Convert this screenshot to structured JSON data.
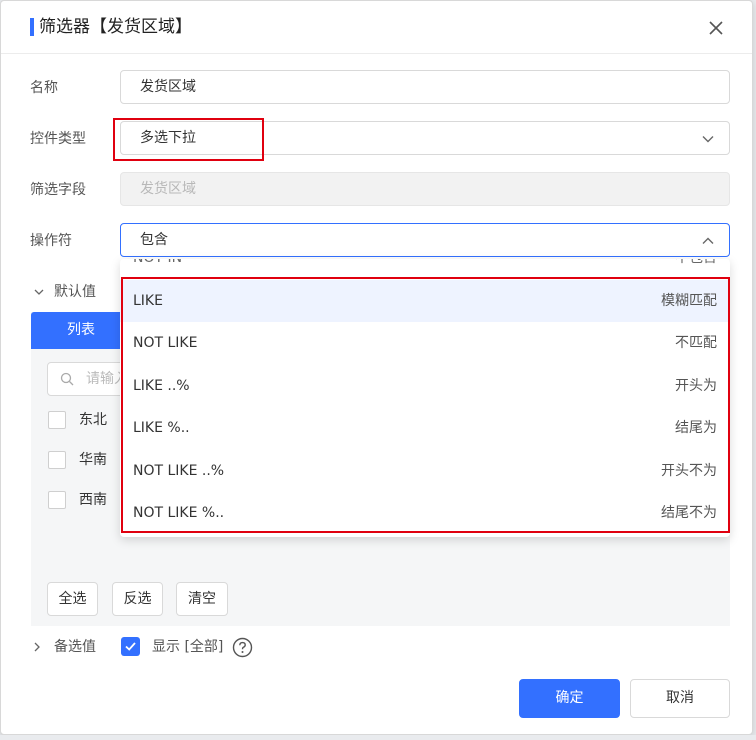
{
  "dialog": {
    "title": "筛选器【发货区域】"
  },
  "form": {
    "name_label": "名称",
    "name_value": "发货区域",
    "control_type_label": "控件类型",
    "control_type_value": "多选下拉",
    "filter_field_label": "筛选字段",
    "filter_field_value": "发货区域",
    "operator_label": "操作符",
    "operator_value": "包含"
  },
  "operator_dropdown": {
    "partial_option": {
      "label": "NOT IN",
      "desc": "不包含"
    },
    "options": [
      {
        "label": "LIKE",
        "desc": "模糊匹配",
        "highlighted": true
      },
      {
        "label": "NOT LIKE",
        "desc": "不匹配",
        "highlighted": false
      },
      {
        "label": "LIKE ..%",
        "desc": "开头为",
        "highlighted": false
      },
      {
        "label": "LIKE %..",
        "desc": "结尾为",
        "highlighted": false
      },
      {
        "label": "NOT LIKE ..%",
        "desc": "开头不为",
        "highlighted": false
      },
      {
        "label": "NOT LIKE %..",
        "desc": "结尾不为",
        "highlighted": false
      }
    ]
  },
  "default_value": {
    "section_label": "默认值",
    "tab_label": "列表",
    "search_placeholder": "请输入",
    "items": [
      "东北",
      "华南",
      "西南"
    ],
    "select_all": "全选",
    "invert": "反选",
    "clear": "清空"
  },
  "candidate": {
    "section_label": "备选值",
    "show_all_label": "显示 [全部]",
    "show_all_checked": true
  },
  "footer": {
    "confirm": "确定",
    "cancel": "取消"
  },
  "colors": {
    "accent": "#3370ff",
    "highlight_box": "#e0000f"
  }
}
